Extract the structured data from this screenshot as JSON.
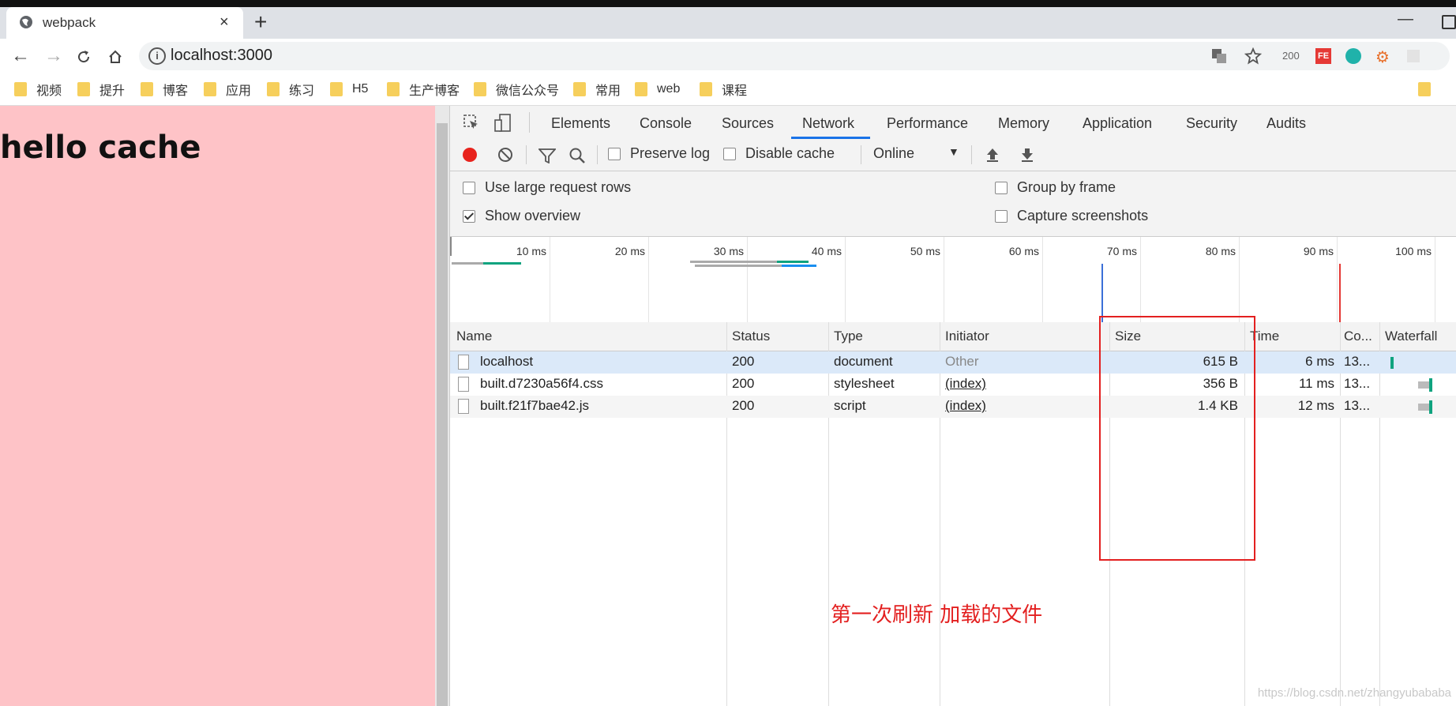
{
  "browser": {
    "tab_title": "webpack",
    "url": "localhost:3000",
    "extension_badge": "200",
    "bookmarks": [
      "视频",
      "提升",
      "博客",
      "应用",
      "练习",
      "H5",
      "生产博客",
      "微信公众号",
      "常用",
      "web",
      "课程"
    ]
  },
  "page": {
    "heading": "hello cache"
  },
  "devtools": {
    "tabs": [
      "Elements",
      "Console",
      "Sources",
      "Network",
      "Performance",
      "Memory",
      "Application",
      "Security",
      "Audits"
    ],
    "active_tab": "Network",
    "toolbar": {
      "preserve_log": "Preserve log",
      "disable_cache": "Disable cache",
      "throttle": "Online"
    },
    "settings": {
      "large_rows": "Use large request rows",
      "show_overview": "Show overview",
      "group_by_frame": "Group by frame",
      "capture_screenshots": "Capture screenshots"
    },
    "overview_ticks": [
      "10 ms",
      "20 ms",
      "30 ms",
      "40 ms",
      "50 ms",
      "60 ms",
      "70 ms",
      "80 ms",
      "90 ms",
      "100 ms"
    ],
    "columns": [
      "Name",
      "Status",
      "Type",
      "Initiator",
      "Size",
      "Time",
      "Co...",
      "Waterfall"
    ],
    "rows": [
      {
        "name": "localhost",
        "status": "200",
        "type": "document",
        "initiator": "Other",
        "size": "615 B",
        "time": "6 ms",
        "co": "13..."
      },
      {
        "name": "built.d7230a56f4.css",
        "status": "200",
        "type": "stylesheet",
        "initiator": "(index)",
        "size": "356 B",
        "time": "11 ms",
        "co": "13..."
      },
      {
        "name": "built.f21f7bae42.js",
        "status": "200",
        "type": "script",
        "initiator": "(index)",
        "size": "1.4 KB",
        "time": "12 ms",
        "co": "13..."
      }
    ]
  },
  "annotation": "第一次刷新  加载的文件",
  "watermark": "https://blog.csdn.net/zhangyubababa",
  "colors": {
    "page_bg": "#fec3c7",
    "annotation": "#e32020",
    "record": "#e8231d",
    "accent": "#1a73e8"
  }
}
